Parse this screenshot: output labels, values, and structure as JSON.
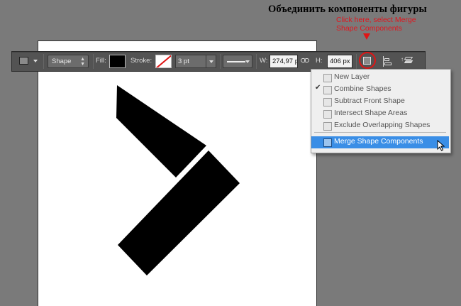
{
  "annotation": {
    "heading": "Объединить компоненты фигуры",
    "note": "Click here, select Merge Shape Components"
  },
  "options_bar": {
    "mode": "Shape",
    "fill_label": "Fill:",
    "stroke_label": "Stroke:",
    "stroke_width": "3 pt",
    "w_label": "W:",
    "w_value": "274,97 p",
    "h_label": "H:",
    "h_value": "406 px"
  },
  "path_ops_menu": {
    "items": [
      {
        "label": "New Layer",
        "checked": false,
        "selected": false
      },
      {
        "label": "Combine Shapes",
        "checked": true,
        "selected": false
      },
      {
        "label": "Subtract Front Shape",
        "checked": false,
        "selected": false
      },
      {
        "label": "Intersect Shape Areas",
        "checked": false,
        "selected": false
      },
      {
        "label": "Exclude Overlapping Shapes",
        "checked": false,
        "selected": false
      },
      {
        "label": "Merge Shape Components",
        "checked": false,
        "selected": true
      }
    ]
  },
  "colors": {
    "highlight": "#3a8ee6",
    "annotation_red": "#e0161e",
    "shape_fill": "#000000"
  }
}
